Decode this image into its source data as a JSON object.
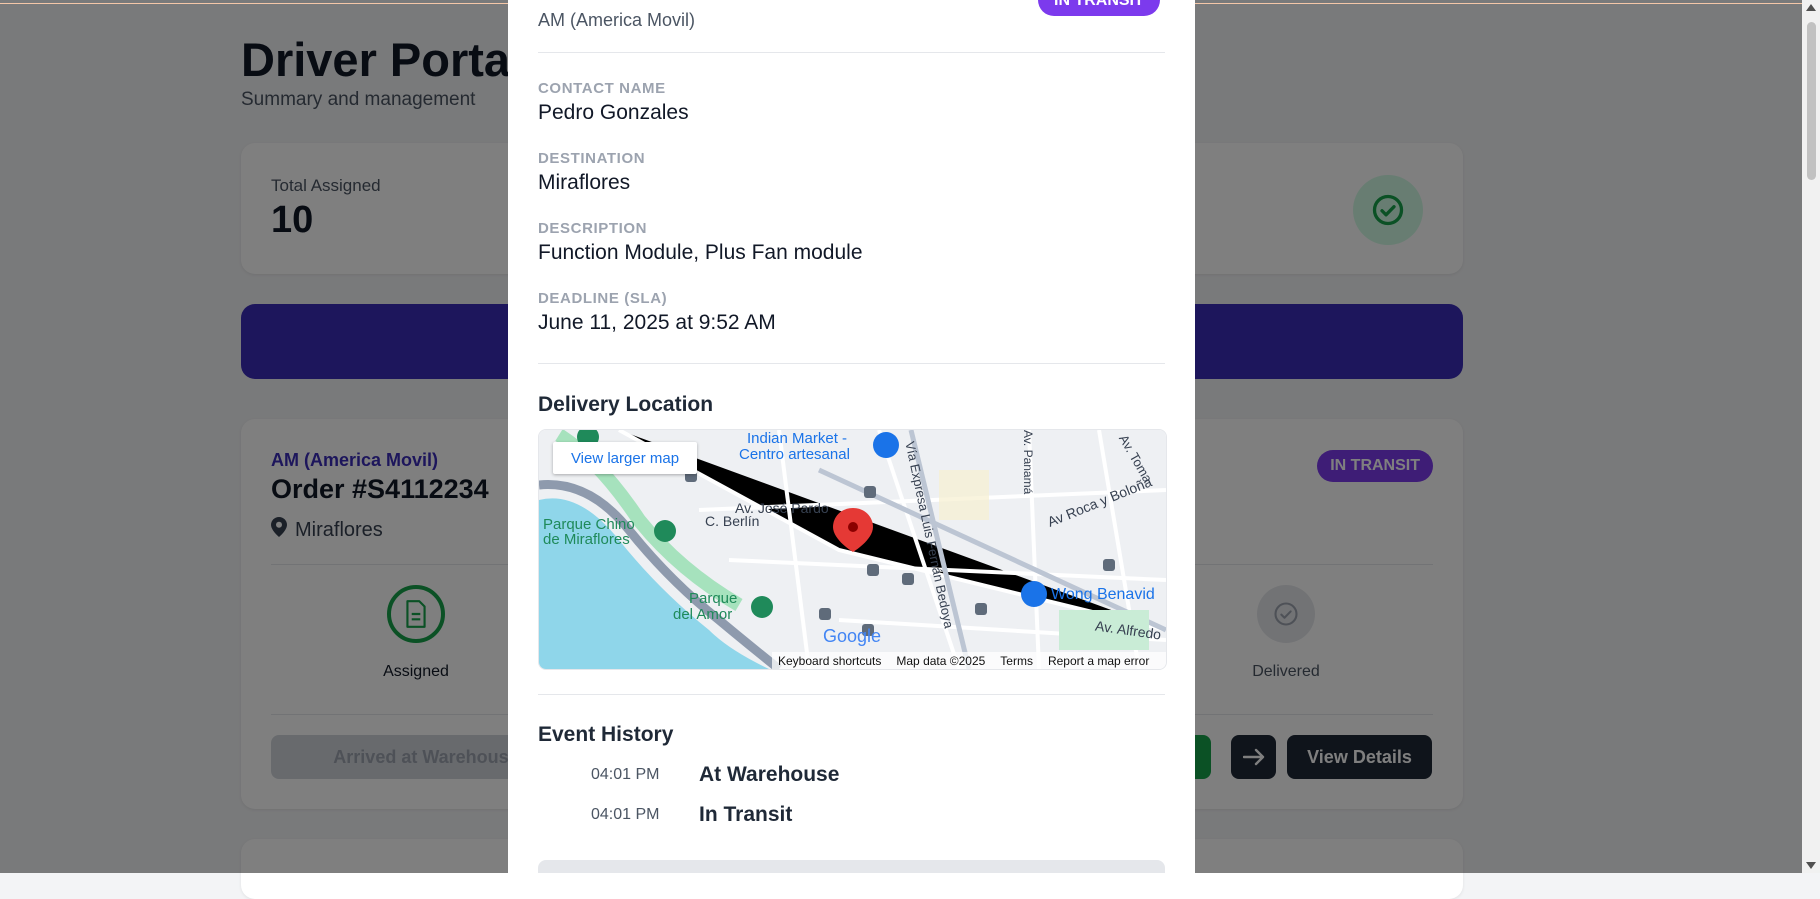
{
  "page": {
    "title": "Driver Portal",
    "subtitle": "Summary and management"
  },
  "stats": {
    "total_label": "Total Assigned",
    "total_value": "10",
    "check_icon": "check-circle-icon"
  },
  "order_card": {
    "company": "AM (America Movil)",
    "order": "Order #S4112234",
    "location": "Miraflores",
    "status": "IN TRANSIT",
    "steps": [
      {
        "label": "Assigned",
        "icon": "document-icon"
      },
      {
        "label": "Delivered",
        "icon": "check-circle-icon"
      }
    ],
    "arrived_label": "Arrived at Warehouse",
    "view_details_label": "View Details"
  },
  "modal": {
    "company": "AM (America Movil)",
    "status": "IN TRANSIT",
    "fields": [
      {
        "label": "CONTACT NAME",
        "value": "Pedro Gonzales"
      },
      {
        "label": "DESTINATION",
        "value": "Miraflores"
      },
      {
        "label": "DESCRIPTION",
        "value": "Function Module, Plus Fan module"
      },
      {
        "label": "DEADLINE (SLA)",
        "value": "June 11, 2025 at 9:52 AM"
      }
    ],
    "delivery_title": "Delivery Location",
    "map": {
      "view_larger": "View larger map",
      "labels": [
        "Indian Market -",
        "Centro artesanal",
        "Av. José Pardo",
        "C. Berlín",
        "Parque Chino",
        "de Miraflores",
        "Parque",
        "del Amor",
        "Av Roca y Boloña",
        "Wong Benavid",
        "Av. Alfredo",
        "Vía Expresa Luis Fernán Bedoya",
        "Av. Toma",
        "Av. Panamá"
      ],
      "footer": [
        "Keyboard shortcuts",
        "Map data ©2025",
        "Terms",
        "Report a map error"
      ],
      "google": "Google"
    },
    "history_title": "Event History",
    "events": [
      {
        "time": "04:01 PM",
        "name": "At Warehouse"
      },
      {
        "time": "04:01 PM",
        "name": "In Transit"
      }
    ]
  },
  "colors": {
    "accent": "#3b2db8",
    "badge": "#7c3aed",
    "success": "#16a34a",
    "dark": "#1f2937"
  }
}
